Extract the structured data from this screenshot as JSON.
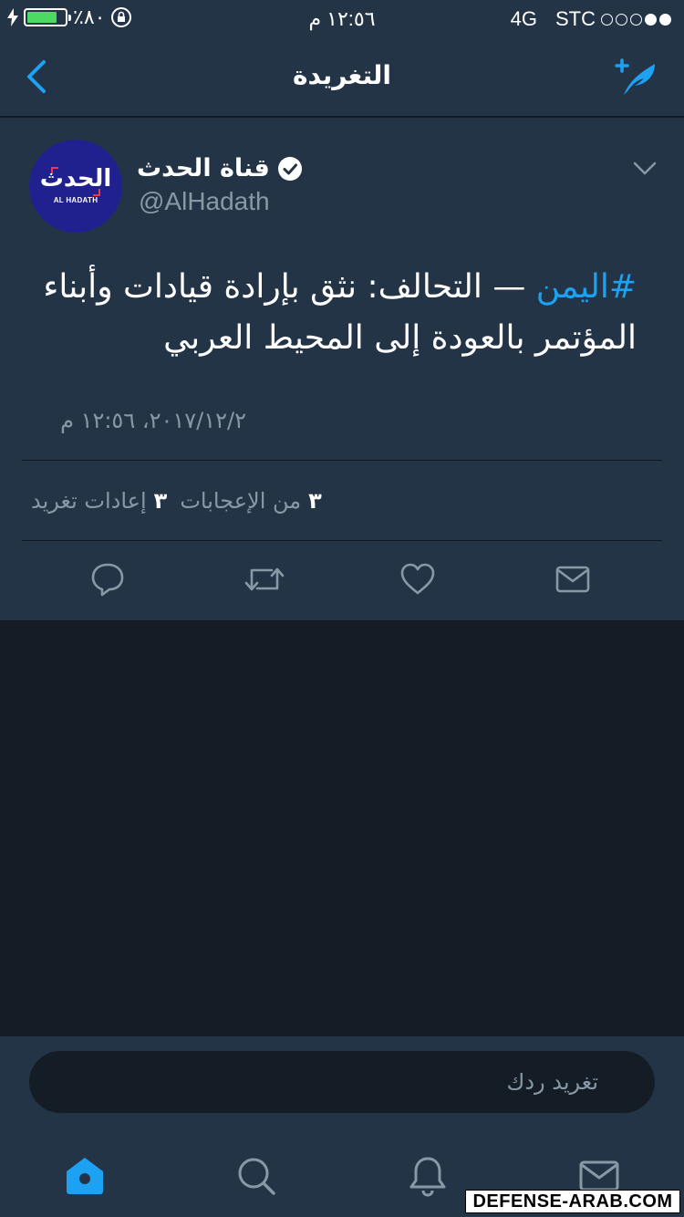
{
  "status_bar": {
    "carrier": "STC",
    "network": "4G",
    "time": "١٢:٥٦ م",
    "battery_label": "٪٨٠",
    "battery_level": 0.8,
    "signal_bars_filled": 2,
    "signal_bars_total": 5
  },
  "nav": {
    "title": "التغريدة",
    "back_icon": "chevron-left-icon",
    "compose_icon": "compose-tweet-icon"
  },
  "tweet": {
    "author_name": "قناة الحدث",
    "verified": true,
    "handle": "@AlHadath",
    "avatar": {
      "logo_text": "الحدث",
      "logo_subtext": "AL HADATH"
    },
    "hashtag": "#اليمن",
    "text": " — التحالف: نثق بإرادة قيادات وأبناء المؤتمر بالعودة إلى المحيط العربي",
    "timestamp": "٢٠١٧/١٢/٢، ١٢:٥٦ م",
    "likes_count": "٣",
    "likes_label": "من الإعجابات",
    "retweets_count": "٣",
    "retweets_label": "إعادات تغريد"
  },
  "actions": [
    "reply-icon",
    "retweet-icon",
    "like-icon",
    "direct-message-icon"
  ],
  "reply": {
    "placeholder": "تغريد ردك"
  },
  "tab_bar": [
    "home-icon",
    "search-icon",
    "notifications-icon",
    "messages-icon"
  ],
  "watermark": "DEFENSE-ARAB.COM",
  "colors": {
    "background": "#141d26",
    "surface": "#243447",
    "accent": "#1da1f2",
    "secondary_text": "#8899a6",
    "battery": "#4cd964"
  }
}
